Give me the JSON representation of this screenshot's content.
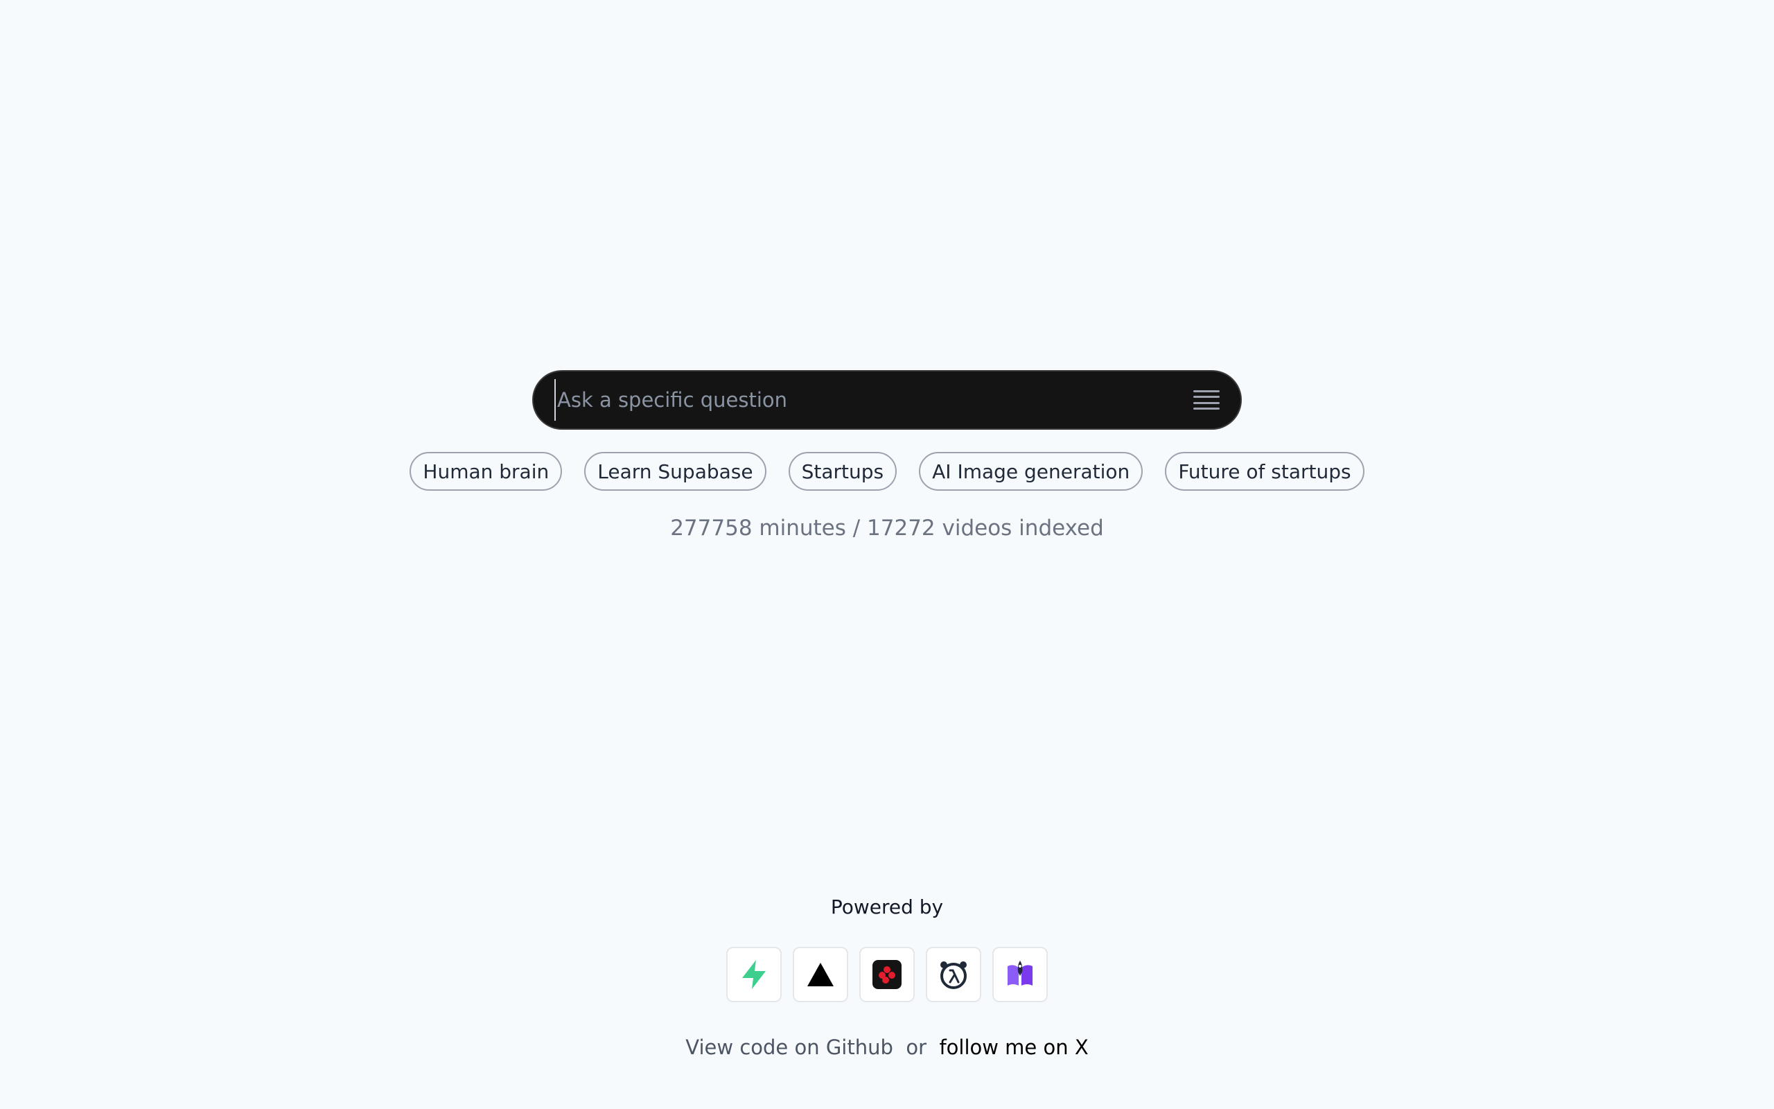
{
  "search": {
    "placeholder": "Ask a specific question",
    "value": "",
    "menu_icon": "hamburger-menu-icon"
  },
  "suggestions": [
    {
      "label": "Human brain"
    },
    {
      "label": "Learn Supabase"
    },
    {
      "label": "Startups"
    },
    {
      "label": "AI Image generation"
    },
    {
      "label": "Future of startups"
    }
  ],
  "stats": {
    "text": "277758 minutes / 17272 videos indexed"
  },
  "footer": {
    "powered_by": "Powered by",
    "logos": [
      {
        "icon": "supabase-icon",
        "color": "#3ecf8e"
      },
      {
        "icon": "vercel-icon",
        "color": "#000000"
      },
      {
        "icon": "red-logo-icon",
        "color": "#e11d2e"
      },
      {
        "icon": "lambda-bear-icon",
        "color": "#1f2937"
      },
      {
        "icon": "purple-bird-icon",
        "color": "#8b5cf6"
      }
    ],
    "code_link": "View code on Github",
    "or": "or",
    "follow_link": "follow me on X"
  }
}
